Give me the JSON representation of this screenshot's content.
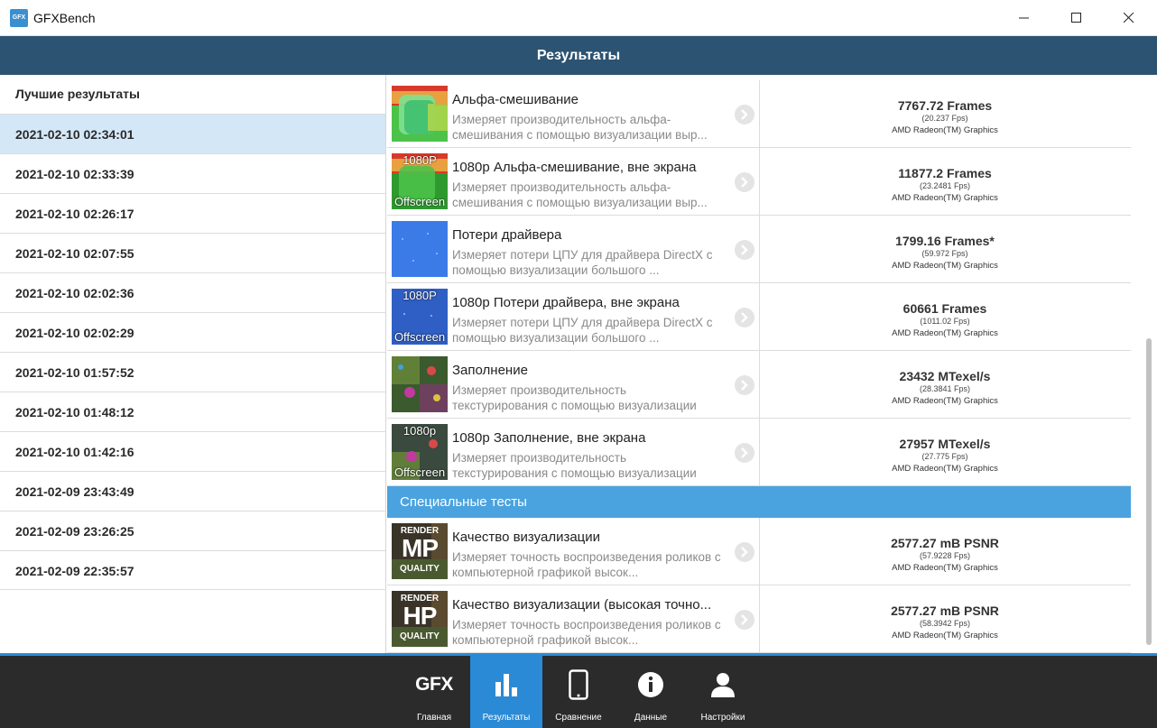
{
  "window": {
    "app_icon_text": "GFX",
    "title": "GFXBench"
  },
  "header": {
    "title": "Результаты"
  },
  "sidebar": {
    "heading": "Лучшие результаты",
    "items": [
      {
        "label": "2021-02-10 02:34:01",
        "selected": true
      },
      {
        "label": "2021-02-10 02:33:39"
      },
      {
        "label": "2021-02-10 02:26:17"
      },
      {
        "label": "2021-02-10 02:07:55"
      },
      {
        "label": "2021-02-10 02:02:36"
      },
      {
        "label": "2021-02-10 02:02:29"
      },
      {
        "label": "2021-02-10 01:57:52"
      },
      {
        "label": "2021-02-10 01:48:12"
      },
      {
        "label": "2021-02-10 01:42:16"
      },
      {
        "label": "2021-02-09 23:43:49"
      },
      {
        "label": "2021-02-09 23:26:25"
      },
      {
        "label": "2021-02-09 22:35:57"
      }
    ]
  },
  "results": [
    {
      "thumb_kind": "alpha",
      "title": "Альфа-смешивание",
      "description": "Измеряет производительность альфа-смешивания с помощью визуализации выр...",
      "score": "7767.72 Frames",
      "fps": "(20.237 Fps)",
      "gpu": "AMD Radeon(TM) Graphics"
    },
    {
      "thumb_kind": "alpha",
      "thumb_top": "1080P",
      "thumb_bottom": "Offscreen",
      "title": "1080p Альфа-смешивание, вне экрана",
      "description": "Измеряет производительность альфа-смешивания с помощью визуализации выр...",
      "score": "11877.2 Frames",
      "fps": "(23.2481 Fps)",
      "gpu": "AMD Radeon(TM) Graphics"
    },
    {
      "thumb_kind": "driver",
      "title": "Потери драйвера",
      "description": "Измеряет потери ЦПУ для драйвера DirectX с помощью визуализации большого ...",
      "score": "1799.16 Frames*",
      "fps": "(59.972 Fps)",
      "gpu": "AMD Radeon(TM) Graphics"
    },
    {
      "thumb_kind": "driver",
      "thumb_top": "1080P",
      "thumb_bottom": "Offscreen",
      "title": "1080p Потери драйвера, вне экрана",
      "description": "Измеряет потери ЦПУ для драйвера DirectX с помощью визуализации большого ...",
      "score": "60661 Frames",
      "fps": "(1011.02 Fps)",
      "gpu": "AMD Radeon(TM) Graphics"
    },
    {
      "thumb_kind": "fill",
      "title": "Заполнение",
      "description": "Измеряет производительность текстурирования с помощью визуализации четы...",
      "score": "23432 MTexel/s",
      "fps": "(28.3841 Fps)",
      "gpu": "AMD Radeon(TM) Graphics"
    },
    {
      "thumb_kind": "fill",
      "thumb_top": "1080p",
      "thumb_bottom": "Offscreen",
      "title": "1080p Заполнение, вне экрана",
      "description": "Измеряет производительность текстурирования с помощью визуализации четы...",
      "score": "27957 MTexel/s",
      "fps": "(27.775 Fps)",
      "gpu": "AMD Radeon(TM) Graphics"
    }
  ],
  "special_section": {
    "title": "Специальные тесты",
    "items": [
      {
        "logo_top": "RENDER",
        "logo_mid": "MP",
        "logo_bottom": "QUALITY",
        "title": "Качество визуализации",
        "description": "Измеряет точность воспроизведения роликов с компьютерной графикой высок...",
        "score": "2577.27 mB PSNR",
        "fps": "(57.9228 Fps)",
        "gpu": "AMD Radeon(TM) Graphics"
      },
      {
        "logo_top": "RENDER",
        "logo_mid": "HP",
        "logo_bottom": "QUALITY",
        "title": "Качество визуализации (высокая точно...",
        "description": "Измеряет точность воспроизведения роликов с компьютерной графикой высок...",
        "score": "2577.27 mB PSNR",
        "fps": "(58.3942 Fps)",
        "gpu": "AMD Radeon(TM) Graphics"
      }
    ]
  },
  "bottom_nav": {
    "gfx_logo": "GFX",
    "items": [
      {
        "label": "Главная",
        "icon": "gfx-logo-icon"
      },
      {
        "label": "Результаты",
        "icon": "bar-chart-icon",
        "active": true
      },
      {
        "label": "Сравнение",
        "icon": "phone-icon"
      },
      {
        "label": "Данные",
        "icon": "info-icon"
      },
      {
        "label": "Настройки",
        "icon": "user-icon"
      }
    ]
  },
  "colors": {
    "header_bg": "#2c5372",
    "accent": "#2a8ad6",
    "section_bar": "#4aa3df",
    "selected_row": "#d4e7f7",
    "bottom_nav_bg": "#2b2b2b"
  }
}
